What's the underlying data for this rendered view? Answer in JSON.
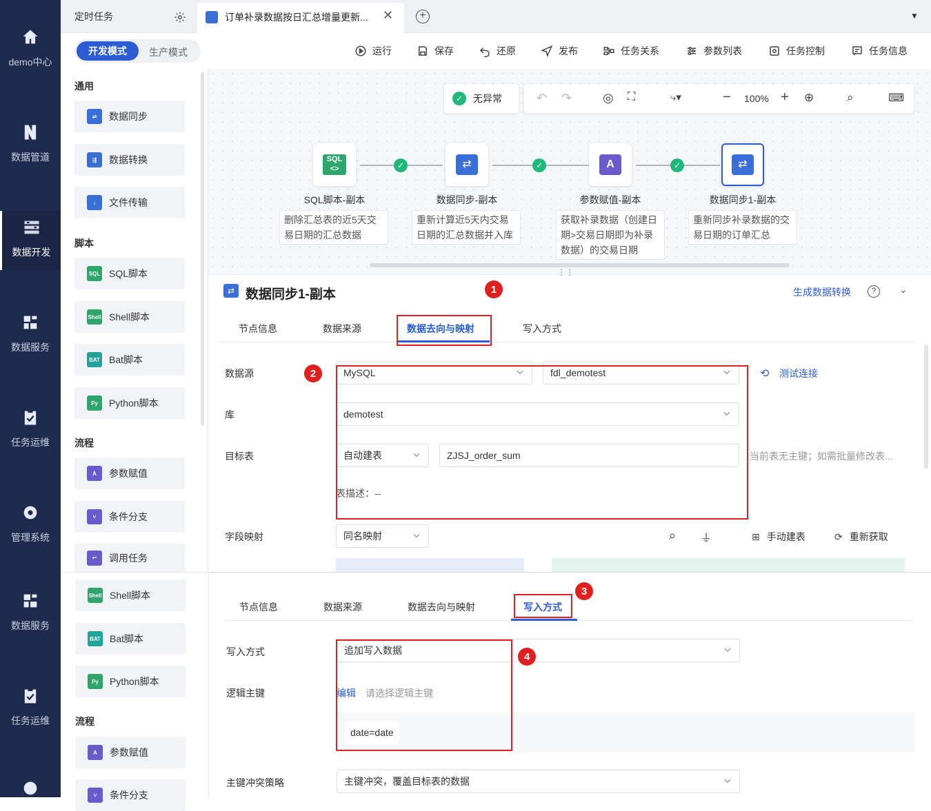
{
  "nav": [
    {
      "label": "demo中心",
      "icon": "home-icon"
    },
    {
      "label": "数据管道",
      "icon": "pipeline-icon"
    },
    {
      "label": "数据开发",
      "icon": "dev-icon"
    },
    {
      "label": "数据服务",
      "icon": "service-icon"
    },
    {
      "label": "任务运维",
      "icon": "ops-icon"
    },
    {
      "label": "管理系统",
      "icon": "gear-icon"
    },
    {
      "label": "数据服务",
      "icon": "service-icon"
    },
    {
      "label": "任务运维",
      "icon": "ops-icon"
    }
  ],
  "tabs": {
    "scheduled": "定时任务",
    "active": "订单补录数据按日汇总增量更新..."
  },
  "modes": {
    "dev": "开发模式",
    "prod": "生产模式"
  },
  "toolbar": [
    "运行",
    "保存",
    "还原",
    "发布",
    "任务关系",
    "参数列表",
    "任务控制",
    "任务信息"
  ],
  "sidebar": {
    "sections": {
      "general": "通用",
      "script": "脚本",
      "flow": "流程"
    },
    "general": [
      "数据同步",
      "数据转换",
      "文件传输"
    ],
    "script": [
      "SQL脚本",
      "Shell脚本",
      "Bat脚本",
      "Python脚本"
    ],
    "flow": [
      "参数赋值",
      "条件分支",
      "调用任务"
    ],
    "lower_script": [
      "Shell脚本",
      "Bat脚本",
      "Python脚本"
    ],
    "lower_flow": [
      "参数赋值",
      "条件分支"
    ]
  },
  "canvas": {
    "status": "无异常",
    "zoom": "100%",
    "nodes": [
      {
        "title": "SQL脚本-副本",
        "desc": "删除汇总表的近5天交易日期的汇总数据"
      },
      {
        "title": "数据同步-副本",
        "desc": "重新计算近5天内交易日期的汇总数据并入库"
      },
      {
        "title": "参数赋值-副本",
        "desc": "获取补录数据（创建日期>交易日期即为补录数据）的交易日期"
      },
      {
        "title": "数据同步1-副本",
        "desc": "重新同步补录数据的交易日期的订单汇总"
      }
    ]
  },
  "panel1": {
    "title": "数据同步1-副本",
    "gen_link": "生成数据转换",
    "tabs": [
      "节点信息",
      "数据来源",
      "数据去向与映射",
      "写入方式"
    ],
    "labels": {
      "source": "数据源",
      "db": "库",
      "target": "目标表",
      "mapping": "字段映射"
    },
    "source_type": "MySQL",
    "source_conn": "fdl_demotest",
    "test_link": "测试连接",
    "db": "demotest",
    "target_mode": "自动建表",
    "target_table": "ZJSJ_order_sum",
    "target_hint": "当前表无主键；如需批量修改表...",
    "table_desc": "表描述：--",
    "mapping_mode": "同名映射",
    "manual": "手动建表",
    "refetch": "重新获取"
  },
  "panel2": {
    "tabs": [
      "节点信息",
      "数据来源",
      "数据去向与映射",
      "写入方式"
    ],
    "labels": {
      "write": "写入方式",
      "pk": "逻辑主键",
      "conflict": "主键冲突策略"
    },
    "write_mode": "追加写入数据",
    "edit": "编辑",
    "pk_placeholder": "请选择逻辑主键",
    "pk_value": "date=date",
    "conflict": "主键冲突，覆盖目标表的数据"
  },
  "badges": [
    "1",
    "2",
    "3",
    "4"
  ],
  "colors": {
    "accent": "#2b5cd6",
    "nav_bg": "#1f2b4e",
    "annotation": "#e02020",
    "ok": "#1fb87b"
  }
}
